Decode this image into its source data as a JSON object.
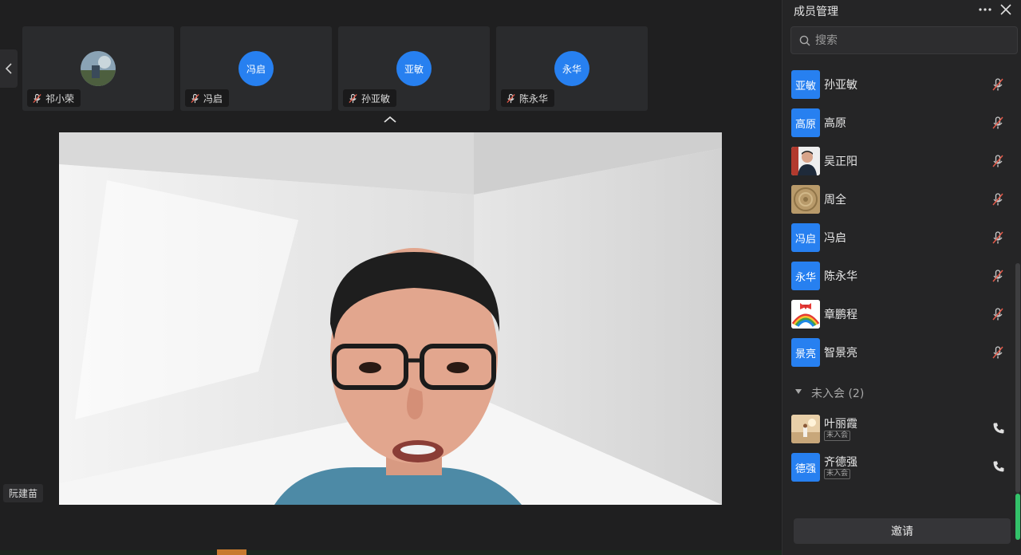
{
  "thumbnails": [
    {
      "name": "祁小荣",
      "avatar_text": "",
      "has_photo": true
    },
    {
      "name": "冯启",
      "avatar_text": "冯启",
      "has_photo": false
    },
    {
      "name": "孙亚敏",
      "avatar_text": "亚敏",
      "has_photo": false
    },
    {
      "name": "陈永华",
      "avatar_text": "永华",
      "has_photo": false
    }
  ],
  "speaker": {
    "name": "阮建苗"
  },
  "panel": {
    "title": "成员管理",
    "search_placeholder": "搜索",
    "members": [
      {
        "avatar_text": "亚敏",
        "name": "孙亚敏",
        "photo": false
      },
      {
        "avatar_text": "高原",
        "name": "高原",
        "photo": false
      },
      {
        "avatar_text": "",
        "name": "吴正阳",
        "photo": true
      },
      {
        "avatar_text": "",
        "name": "周全",
        "photo": true
      },
      {
        "avatar_text": "冯启",
        "name": "冯启",
        "photo": false
      },
      {
        "avatar_text": "永华",
        "name": "陈永华",
        "photo": false
      },
      {
        "avatar_text": "",
        "name": "章鹏程",
        "photo": true
      },
      {
        "avatar_text": "景亮",
        "name": "智景亮",
        "photo": false
      }
    ],
    "absent_header": "未入会 (2)",
    "absent_members": [
      {
        "avatar_text": "",
        "name": "叶丽霞",
        "badge": "未入会",
        "photo": true
      },
      {
        "avatar_text": "德强",
        "name": "齐德强",
        "badge": "未入会",
        "photo": false
      }
    ],
    "invite_label": "邀请"
  },
  "colors": {
    "accent_blue": "#2780f0",
    "panel_bg": "#252526",
    "main_bg": "#1f1f20",
    "active_green": "#33c26a"
  }
}
